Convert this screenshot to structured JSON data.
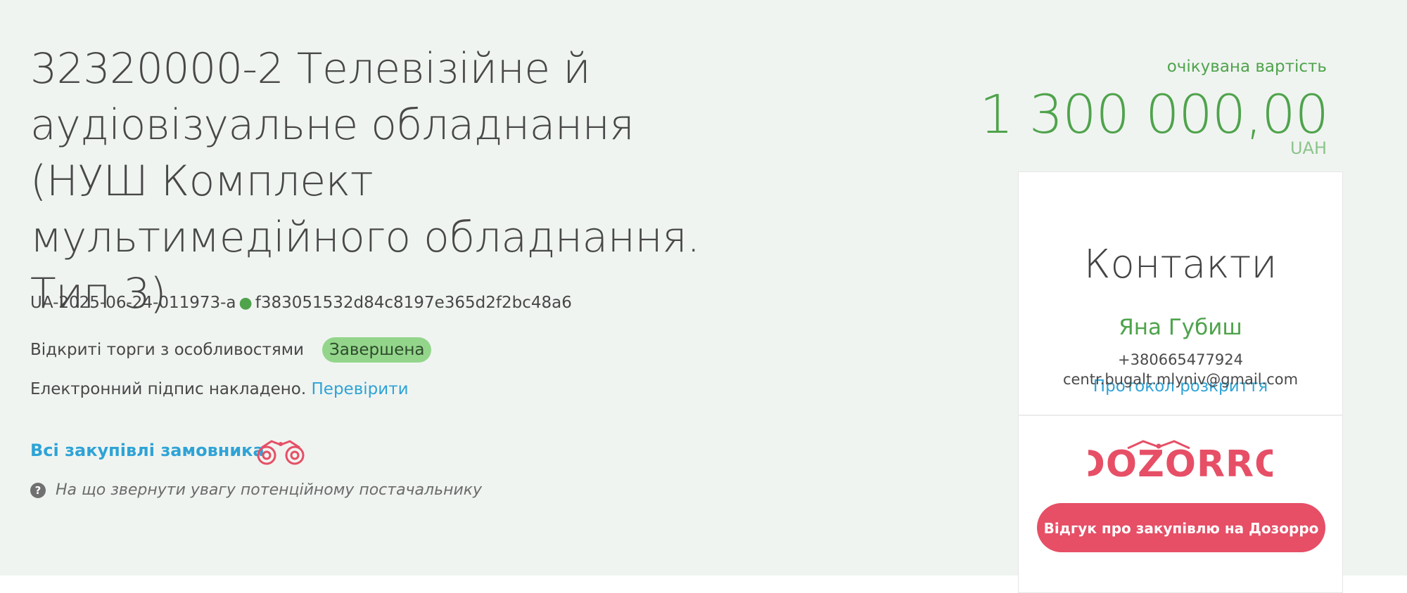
{
  "tender": {
    "title": "32320000-2 Телевізійне й аудіовізуальне обладнання (НУШ Комплект мультимедійного обладнання. Тип 3)",
    "id": "UA-2025-06-24-011973-a",
    "hash": "f383051532d84c8197e365d2f2bc48a6",
    "procedure_type": "Відкриті торги з особливостями",
    "status": "Завершена",
    "signature_text": "Електронний підпис накладено.",
    "signature_link": "Перевірити",
    "buyer_link": "Всі закупівлі замовника",
    "hint": "На що звернути увагу потенційному постачальнику"
  },
  "price": {
    "caption": "очікувана вартість",
    "value": "1 300 000,00",
    "currency": "UAH"
  },
  "card": {
    "protocol_link": "Протокол розкриття",
    "contacts_heading": "Контакти",
    "contact_name": "Яна Губиш",
    "contact_phone": "+380665477924",
    "contact_email": "centr.bugalt.mlyniv@gmail.com",
    "logo_text": "DOZORRO",
    "dozorro_button": "Відгук про закупівлю на Дозорро"
  },
  "colors": {
    "green_accent": "#4fa34c",
    "link_blue": "#2ea3d6",
    "dozorro_red": "#e64f66",
    "status_badge": "#93d68b",
    "hero_background": "#f0f4f1"
  },
  "icons": {
    "separator": "green-dot-icon",
    "binoculars": "binoculars-icon",
    "hint": "question-circle-icon"
  }
}
